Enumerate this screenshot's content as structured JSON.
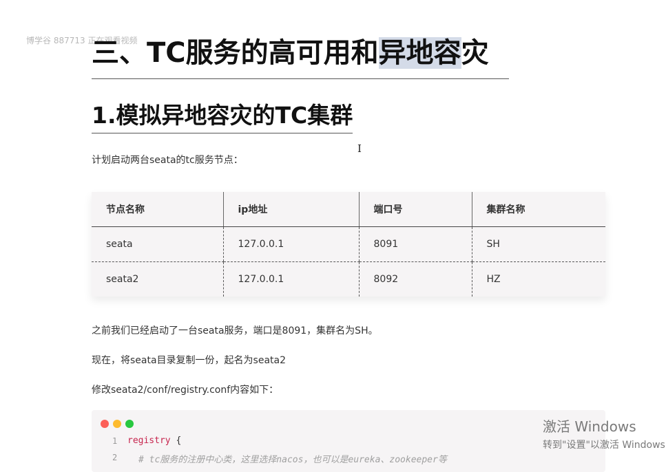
{
  "watermark": "博学谷 887713 正在观看视频",
  "heading1": {
    "before": "三、TC服务的高可用和",
    "highlight": "异地容",
    "after": "灾"
  },
  "heading2": "1.模拟异地容灾的TC集群",
  "cursor": "I",
  "intro": "计划启动两台seata的tc服务节点：",
  "table": {
    "headers": [
      "节点名称",
      "ip地址",
      "端口号",
      "集群名称"
    ],
    "rows": [
      [
        "seata",
        "127.0.0.1",
        "8091",
        "SH"
      ],
      [
        "seata2",
        "127.0.0.1",
        "8092",
        "HZ"
      ]
    ]
  },
  "para2": "之前我们已经启动了一台seata服务，端口是8091，集群名为SH。",
  "para3": "现在，将seata目录复制一份，起名为seata2",
  "para4": "修改seata2/conf/registry.conf内容如下：",
  "code": {
    "lines": [
      {
        "num": "1",
        "keyword": "registry",
        "rest": " {"
      },
      {
        "num": "2",
        "comment": "# tc服务的注册中心类，这里选择nacos，也可以是eureka、zookeeper等"
      }
    ]
  },
  "activation": {
    "title": "激活 Windows",
    "subtitle": "转到\"设置\"以激活 Windows"
  }
}
